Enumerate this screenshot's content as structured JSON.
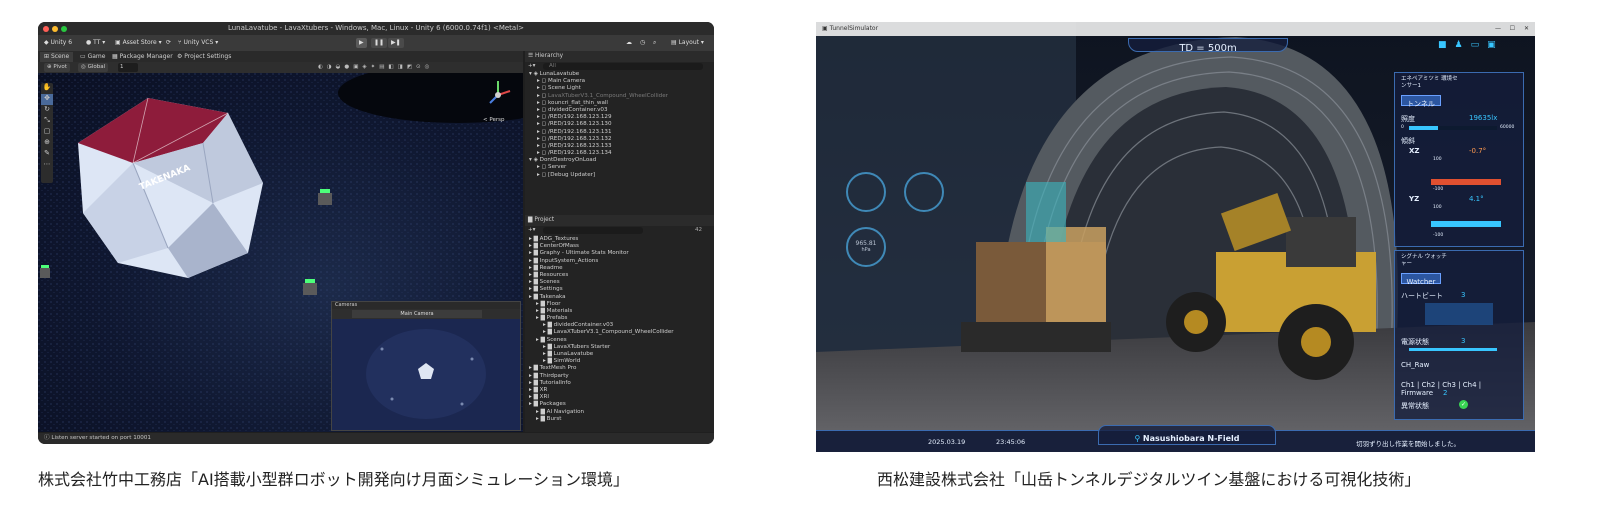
{
  "left_panel": {
    "window_title": "LunaLavatube - LavaXtubers - Windows, Mac, Linux - Unity 6 (6000.0.74f1) <Metal>",
    "toolbar": {
      "unity_label": "Unity 6",
      "account_label": "TT",
      "asset_store_label": "Asset Store",
      "vcs_label": "Unity VCS",
      "layout_label": "Layout"
    },
    "tabs": [
      "Scene",
      "Game",
      "Package Manager",
      "Project Settings"
    ],
    "scene_toolbar": {
      "pivot": "Pivot",
      "global": "Global",
      "grid_value": "1"
    },
    "persp_label": "< Persp",
    "dome_brand": "TAKENAKA",
    "camera_window": {
      "title": "Cameras",
      "dropdown": "Main Camera"
    },
    "hierarchy": {
      "title": "Hierarchy",
      "search_placeholder": "All",
      "items": [
        "LunaLavatube",
        "Main Camera",
        "Scene Light",
        "LavaXTuberV3.1_Compound_WheelCollider",
        "kouncri_flat_thin_wall",
        "dividedContainer.v03",
        "/RED/192.168.123.129",
        "/RED/192.168.123.130",
        "/RED/192.168.123.131",
        "/RED/192.168.123.132",
        "/RED/192.168.123.133",
        "/RED/192.168.123.134",
        "DontDestroyOnLoad",
        "Server",
        "[Debug Updater]"
      ]
    },
    "project": {
      "title": "Project",
      "count_badge": "42",
      "items": [
        "ADG_Textures",
        "CenterOfMass",
        "Graphy - Ultimate Stats Monitor",
        "InputSystem_Actions",
        "Readme",
        "Resources",
        "Scenes",
        "Settings",
        "Takenaka",
        "Floor",
        "Materials",
        "Prefabs",
        "dividedContainer.v03",
        "LavaXTuberV3.1_Compound_WheelCollider",
        "Scenes",
        "LavaXTubers Starter",
        "LunaLavatube",
        "SimWorld",
        "TextMesh Pro",
        "Thirdparty",
        "TutorialInfo",
        "XR",
        "XRI",
        "Packages",
        "AI Navigation",
        "Burst"
      ]
    },
    "status_text": "Listen server started on port 10001",
    "caption": "株式会社竹中工務店「AI搭載小型群ロボット開発向け月面シミュレーション環境」"
  },
  "right_panel": {
    "app_title": "TunnelSimulator",
    "distance_label": "TD = 500m",
    "env_sensor": {
      "title": "エネペアミツミ 環境センサー1",
      "tunnel_button": "トンネル",
      "illuminance_label": "照度",
      "illuminance_value": "19635lx",
      "illuminance_min": "0",
      "illuminance_max": "60000",
      "incline_label": "傾斜",
      "xz_label": "XZ",
      "xz_value": "-0.7°",
      "yz_label": "YZ",
      "yz_value": "4.1°",
      "axis_top": "100",
      "axis_bottom": "-100"
    },
    "signal_watcher": {
      "title": "シグナル ウォッチャー",
      "watcher_button": "Watcher",
      "heartbeat_label": "ハートビート",
      "heartbeat_value": "3",
      "power_label": "電源状態",
      "power_value": "3",
      "ch_raw_label": "CH_Raw",
      "channels": [
        "Ch1",
        "Ch2",
        "Ch3",
        "Ch4"
      ],
      "firmware_label": "Firmware",
      "firmware_value": "2",
      "error_label": "異常状態"
    },
    "left_gauges": {
      "pressure_value": "965.81",
      "pressure_unit": "hPa"
    },
    "footer": {
      "date": "2025.03.19",
      "time": "23:45:06",
      "location": "Nasushiobara N-Field",
      "message": "切羽ずり出し作業を開始しました。"
    },
    "caption": "西松建設株式会社「山岳トンネルデジタルツイン基盤における可視化技術」"
  },
  "colors": {
    "unity_bg": "#1f1f1f",
    "hud_blue": "#3b6bb0",
    "hud_text": "#e6f0ff",
    "accent_cyan": "#38c6ff",
    "ok_green": "#39d353",
    "xz_bar": "#e05030"
  }
}
